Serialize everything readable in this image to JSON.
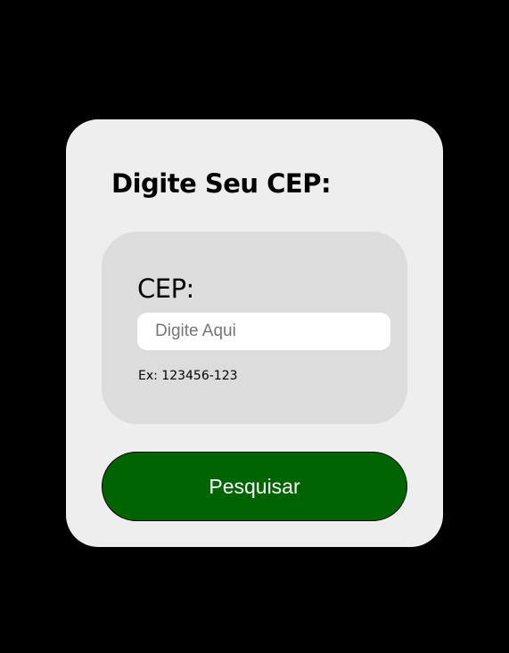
{
  "form": {
    "title": "Digite Seu CEP:",
    "cep_label": "CEP:",
    "cep_input": {
      "value": "",
      "placeholder": "Digite Aqui"
    },
    "example_text": "Ex: 123456-123",
    "search_button_label": "Pesquisar"
  },
  "colors": {
    "page_background": "#000000",
    "card_background": "#eeeeee",
    "field_box_background": "#dcdcdc",
    "input_background": "#ffffff",
    "button_background": "#006400",
    "button_text": "#ffffff"
  }
}
